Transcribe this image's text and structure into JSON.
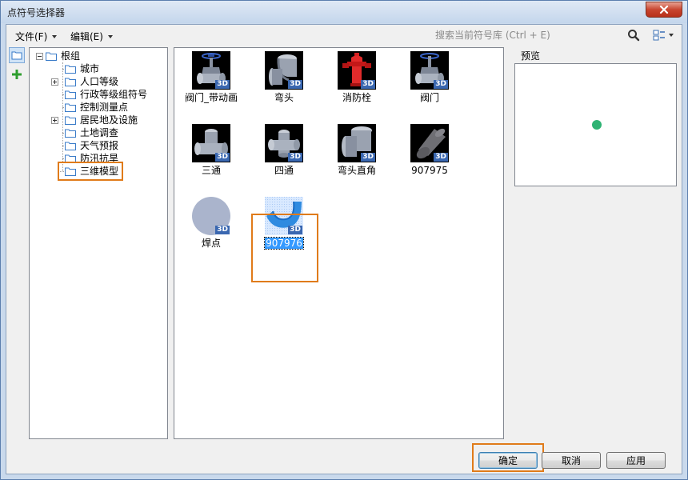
{
  "window": {
    "title": "点符号选择器"
  },
  "menubar": {
    "file_label": "文件(F)",
    "edit_label": "编辑(E)",
    "search_placeholder": "搜索当前符号库 (Ctrl + E)"
  },
  "tree": {
    "root_label": "根组",
    "items": [
      {
        "label": "城市",
        "expandable": false
      },
      {
        "label": "人口等级",
        "expandable": true
      },
      {
        "label": "行政等级组符号",
        "expandable": false
      },
      {
        "label": "控制测量点",
        "expandable": false
      },
      {
        "label": "居民地及设施",
        "expandable": true
      },
      {
        "label": "土地调查",
        "expandable": false
      },
      {
        "label": "天气预报",
        "expandable": false
      },
      {
        "label": "防汛抗旱",
        "expandable": false
      },
      {
        "label": "三维模型",
        "expandable": false,
        "highlighted": true
      }
    ]
  },
  "symbols": [
    {
      "label": "阀门_带动画",
      "icon": "valve-animated-3d-icon",
      "badge": "3D"
    },
    {
      "label": "弯头",
      "icon": "elbow-3d-icon",
      "badge": "3D"
    },
    {
      "label": "消防栓",
      "icon": "fire-hydrant-3d-icon",
      "badge": "3D"
    },
    {
      "label": "阀门",
      "icon": "valve-3d-icon",
      "badge": "3D"
    },
    {
      "label": "三通",
      "icon": "tee-3d-icon",
      "badge": "3D"
    },
    {
      "label": "四通",
      "icon": "cross-3d-icon",
      "badge": "3D"
    },
    {
      "label": "弯头直角",
      "icon": "right-angle-elbow-3d-icon",
      "badge": "3D"
    },
    {
      "label": "907975",
      "icon": "pipe-reducer-3d-icon",
      "badge": "3D"
    },
    {
      "label": "焊点",
      "icon": "weld-point-3d-icon",
      "badge": "3D"
    },
    {
      "label": "907976",
      "icon": "blue-pipe-3d-icon",
      "badge": "3D",
      "selected": true
    }
  ],
  "preview": {
    "label": "预览",
    "dot_color": "#2eb373"
  },
  "buttons": {
    "ok": "确定",
    "cancel": "取消",
    "apply": "应用"
  },
  "colors": {
    "highlight": "#e07b1a",
    "selection": "#3399ff",
    "badge": "#3a67b0"
  }
}
